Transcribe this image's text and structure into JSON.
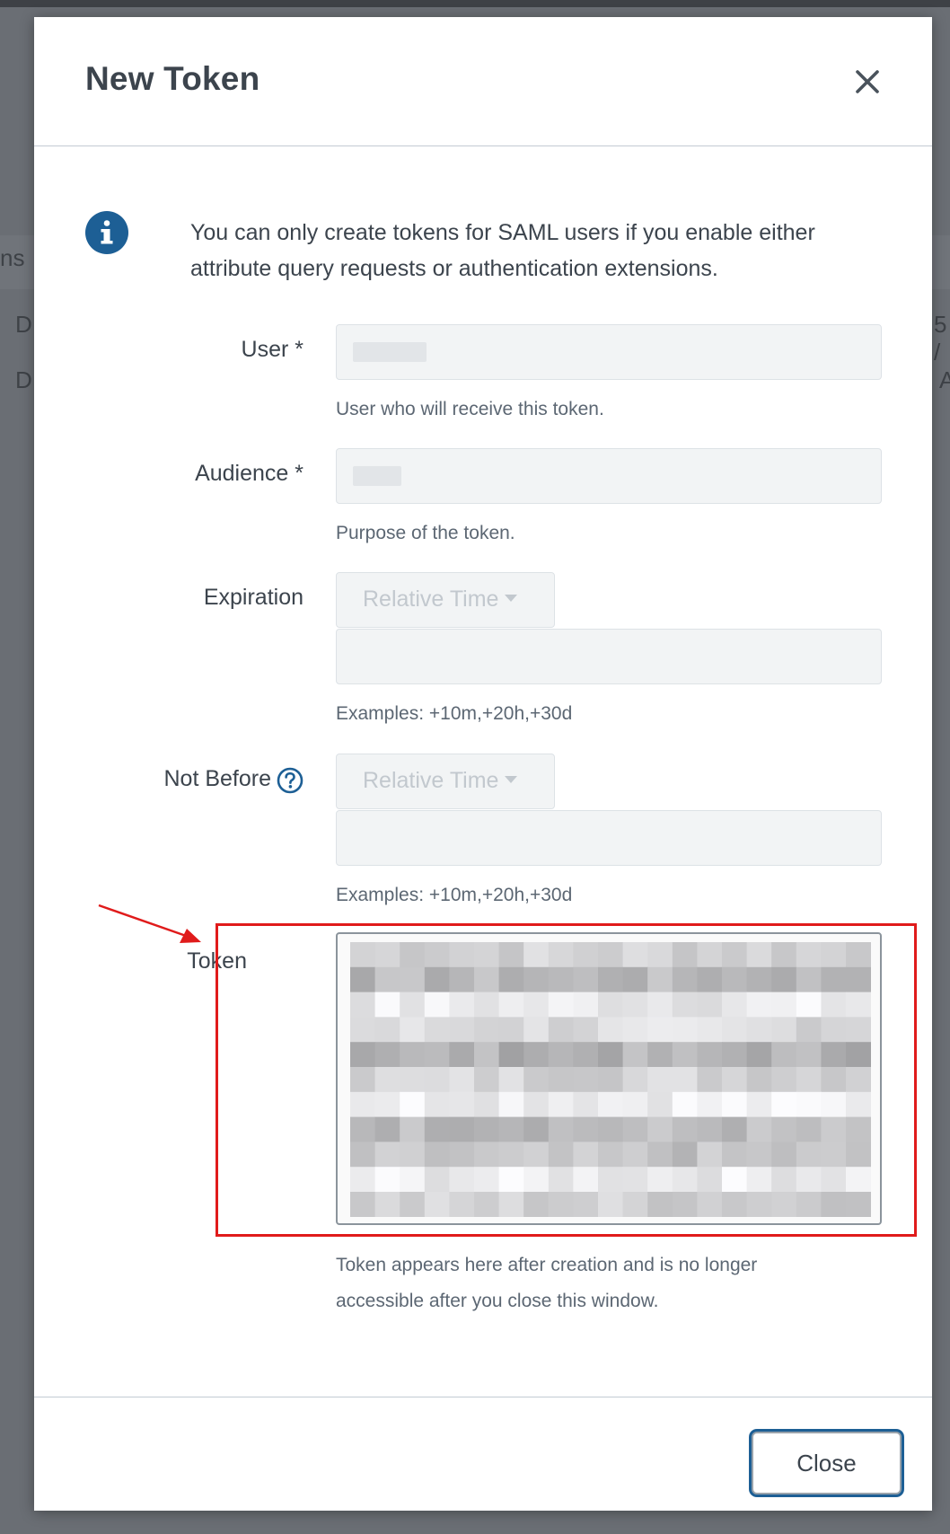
{
  "modal": {
    "title": "New Token",
    "info_text": "You can only create tokens for SAML users if you enable either attribute query requests or authentication extensions.",
    "fields": {
      "user": {
        "label": "User *",
        "value": "",
        "help": "User who will receive this token."
      },
      "audience": {
        "label": "Audience *",
        "value": "",
        "help": "Purpose of the token."
      },
      "expiration": {
        "label": "Expiration",
        "dropdown_value": "Relative Time",
        "value": "",
        "help": "Examples: +10m,+20h,+30d"
      },
      "not_before": {
        "label": "Not Before",
        "dropdown_value": "Relative Time",
        "value": "",
        "help": "Examples: +10m,+20h,+30d"
      },
      "token": {
        "label": "Token",
        "help": "Token appears here after creation and is no longer accessible after you close this window."
      }
    },
    "footer": {
      "close_label": "Close"
    }
  },
  "background": {
    "fragments": [
      "ns",
      "D",
      "D",
      "5 /",
      "A"
    ]
  },
  "icons": {
    "close": "close-icon",
    "info": "info-icon",
    "help": "question-circle-icon",
    "caret": "caret-down-icon"
  },
  "colors": {
    "accent": "#1d5f95",
    "annotation": "#e01b1b",
    "input_bg": "#f2f4f5",
    "text": "#3c444d",
    "help_text": "#5c6773"
  }
}
